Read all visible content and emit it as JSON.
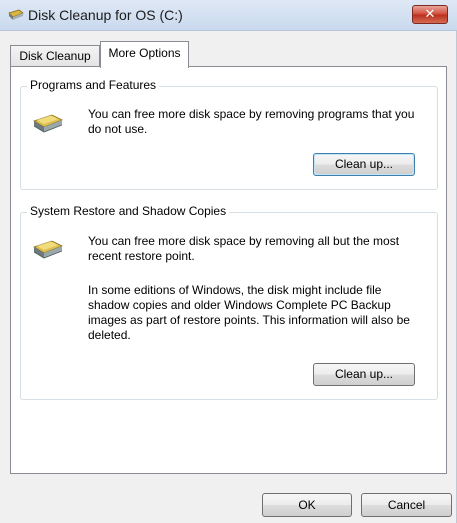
{
  "window": {
    "title": "Disk Cleanup for OS (C:)",
    "close_icon": "close-icon"
  },
  "tabs": [
    {
      "label": "Disk Cleanup",
      "selected": false
    },
    {
      "label": "More Options",
      "selected": true
    }
  ],
  "programs_group": {
    "title": "Programs and Features",
    "description": "You can free more disk space by removing programs that you do not use.",
    "button_label": "Clean up...",
    "icon": "drive-icon"
  },
  "restore_group": {
    "title": "System Restore and Shadow Copies",
    "description": "You can free more disk space by removing all but the most recent restore point.",
    "note": "In some editions of Windows, the disk might include file shadow copies and older Windows Complete PC Backup images as part of restore points. This information will also be deleted.",
    "button_label": "Clean up...",
    "icon": "drive-icon"
  },
  "footer": {
    "ok_label": "OK",
    "cancel_label": "Cancel"
  },
  "colors": {
    "close_button": "#c9432f",
    "focus_border": "#3c7fb1",
    "drive_brass": "#d9b544",
    "drive_body": "#7b8a8e"
  }
}
